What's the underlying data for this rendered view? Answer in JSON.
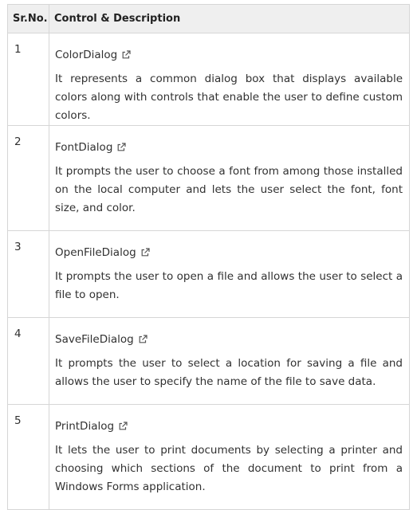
{
  "table": {
    "headers": {
      "no": "Sr.No.",
      "desc": "Control & Description"
    },
    "rows": [
      {
        "no": "1",
        "control": "ColorDialog",
        "description": "It represents a common dialog box that displays available colors along with controls that enable the user to define custom colors."
      },
      {
        "no": "2",
        "control": "FontDialog",
        "description": "It prompts the user to choose a font from among those installed on the local computer and lets the user select the font, font size, and color."
      },
      {
        "no": "3",
        "control": "OpenFileDialog",
        "description": "It prompts the user to open a file and allows the user to select a file to open."
      },
      {
        "no": "4",
        "control": "SaveFileDialog",
        "description": "It prompts the user to select a location for saving a file and allows the user to specify the name of the file to save data."
      },
      {
        "no": "5",
        "control": "PrintDialog",
        "description": "It lets the user to print documents by selecting a printer and choosing which sections of the document to print from a Windows Forms application."
      }
    ]
  },
  "icons": {
    "external_link": "external-link-icon"
  }
}
